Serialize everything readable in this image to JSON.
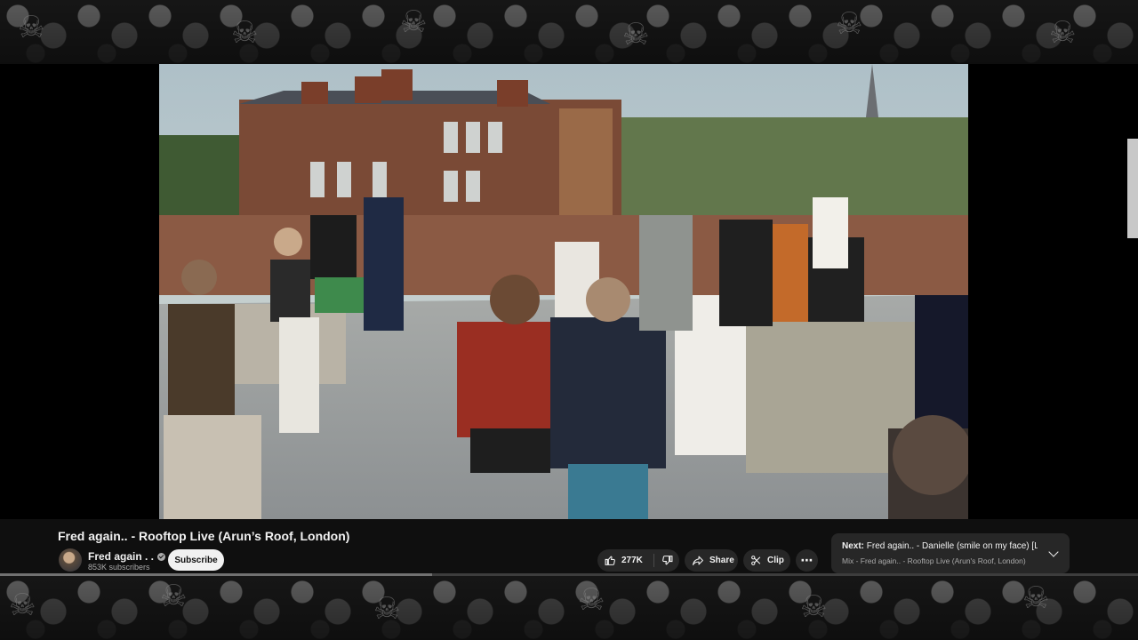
{
  "video": {
    "title": "Fred again.. - Rooftop Live (Arun’s Roof, London)",
    "progress_fraction": 0.38
  },
  "channel": {
    "name": "Fred again . .",
    "subscribers": "853K subscribers",
    "subscribe_label": "Subscribe"
  },
  "actions": {
    "like_count": "277K",
    "share_label": "Share",
    "clip_label": "Clip",
    "more_icon": "⋯"
  },
  "up_next": {
    "prefix": "Next:",
    "title": " Fred again.. - Danielle (smile on my face) [Liv...",
    "subtitle": "Mix - Fred again.. - Rooftop Live (Arun's Roof, London)"
  },
  "colors": {
    "background": "#0f0f0f",
    "pill": "#272727",
    "text_primary": "#f1f1f1",
    "text_secondary": "#aaaaaa",
    "subscribe_bg": "#f1f1f1"
  },
  "icons": [
    "like-icon",
    "dislike-icon",
    "share-icon",
    "clip-icon",
    "more-icon",
    "verified-icon",
    "chevron-down-icon",
    "skull-pattern"
  ]
}
